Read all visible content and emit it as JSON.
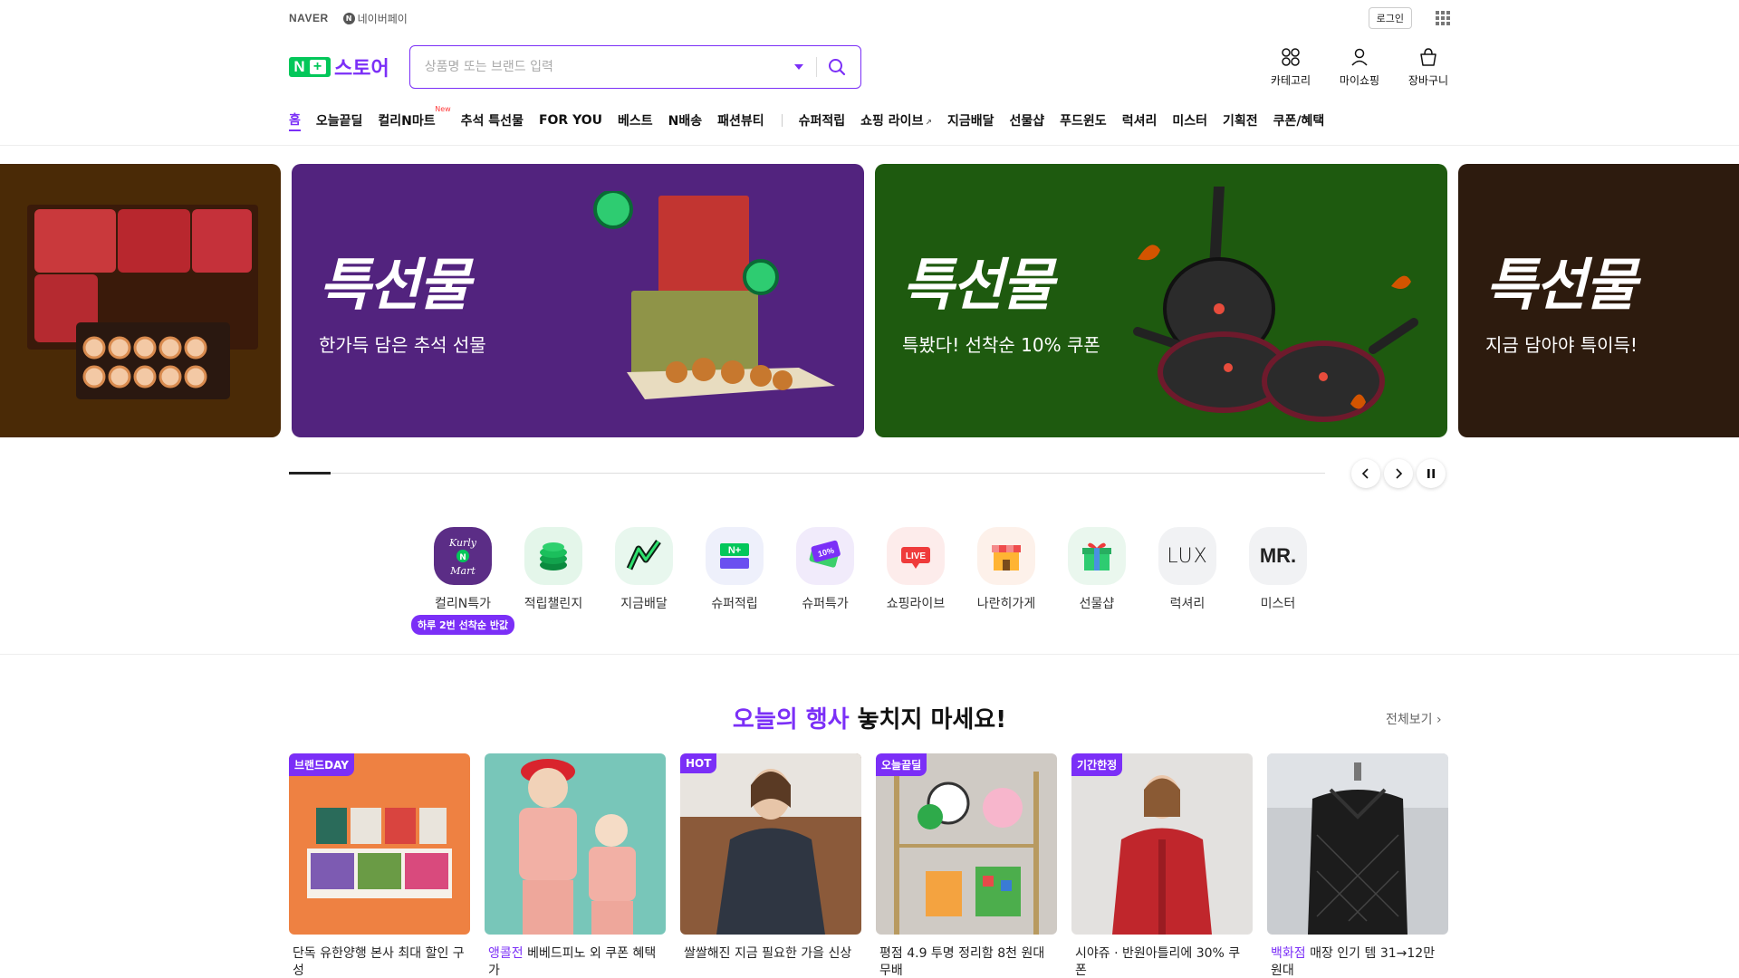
{
  "util": {
    "naver": "NAVER",
    "npay_icon": "N",
    "npay": "네이버페이",
    "login": "로그인"
  },
  "header": {
    "logo_n": "N",
    "logo_plus": "+",
    "logo_store": "스토어",
    "search_placeholder": "상품명 또는 브랜드 입력",
    "icons": [
      {
        "label": "카테고리",
        "icon": "category-icon"
      },
      {
        "label": "마이쇼핑",
        "icon": "user-icon"
      },
      {
        "label": "장바구니",
        "icon": "cart-icon"
      }
    ]
  },
  "gnb": {
    "items": [
      "홈",
      "오늘끝딜",
      "컬리N마트",
      "추석 특선물",
      "FOR YOU",
      "베스트",
      "N배송",
      "패션뷰티",
      "슈퍼적립",
      "쇼핑 라이브",
      "지금배달",
      "선물샵",
      "푸드윈도",
      "럭셔리",
      "미스터",
      "기획전",
      "쿠폰/혜택"
    ],
    "new_badge": "New",
    "ext_mark": "↗"
  },
  "banners": [
    {
      "title": "특선물",
      "subtitle": "한가득 담은 추석 선물",
      "color": "#52237e"
    },
    {
      "title": "특선물",
      "subtitle": "특봤다! 선착순 10% 쿠폰",
      "color": "#1e5a0f"
    },
    {
      "title": "특선물",
      "subtitle": "지금 담아야 특이득!",
      "color": "#2d1b0e"
    }
  ],
  "carousel": {
    "progress": 0.04
  },
  "shortcuts": [
    {
      "label": "컬리N특가",
      "icon": "kurly-n-mart-icon",
      "bg": "#5b2d86",
      "glyph": "Kurly",
      "pill": "하루 2번 선착순 반값"
    },
    {
      "label": "적립챌린지",
      "icon": "coin-stack-icon",
      "bg": "#e4f6ea",
      "glyph": "≡"
    },
    {
      "label": "지금배달",
      "icon": "delivery-bolt-icon",
      "bg": "#e8f7ee",
      "glyph": "⚡"
    },
    {
      "label": "슈퍼적립",
      "icon": "super-point-icon",
      "bg": "#eef0fb",
      "glyph": "N+"
    },
    {
      "label": "슈퍼특가",
      "icon": "ten-percent-coupon-icon",
      "bg": "#f1ebfb",
      "glyph": "10%"
    },
    {
      "label": "쇼핑라이브",
      "icon": "live-icon",
      "bg": "#fdeceb",
      "glyph": "LIVE"
    },
    {
      "label": "나란히가게",
      "icon": "store-front-icon",
      "bg": "#fdf1ea",
      "glyph": "▦"
    },
    {
      "label": "선물샵",
      "icon": "gift-icon",
      "bg": "#eaf7ee",
      "glyph": "🎁"
    },
    {
      "label": "럭셔리",
      "icon": "lux-icon",
      "bg": "#f1f2f4",
      "glyph": "LUX"
    },
    {
      "label": "미스터",
      "icon": "mr-icon",
      "bg": "#f1f2f4",
      "glyph": "MR."
    }
  ],
  "events": {
    "title_hl": "오늘의 행사",
    "title_rest": " 놓치지 마세요!",
    "see_all": "전체보기 ›",
    "cards": [
      {
        "tag": "브랜드DAY",
        "hl": "",
        "text": "단독 유한양행 본사 최대 할인 구성",
        "bg": "#ee8142"
      },
      {
        "tag": "",
        "hl": "앵콜전",
        "text": " 베베드피노 외 쿠폰 혜택가",
        "bg": "#78c6b9"
      },
      {
        "tag": "HOT",
        "hl": "",
        "text": "쌀쌀해진 지금 필요한 가을 신상",
        "bg": "#8b5a3a"
      },
      {
        "tag": "오늘끝딜",
        "hl": "",
        "text": "평점 4.9 투명 정리함 8천 원대 무배",
        "bg": "#cfcac4"
      },
      {
        "tag": "기간한정",
        "hl": "",
        "text": "시야쥬 · 반원아틀리에 30% 쿠폰",
        "bg": "#e3e1df"
      },
      {
        "tag": "",
        "hl": "백화점",
        "text": " 매장 인기 템 31→12만원대",
        "bg": "#c9ccd0"
      }
    ]
  }
}
